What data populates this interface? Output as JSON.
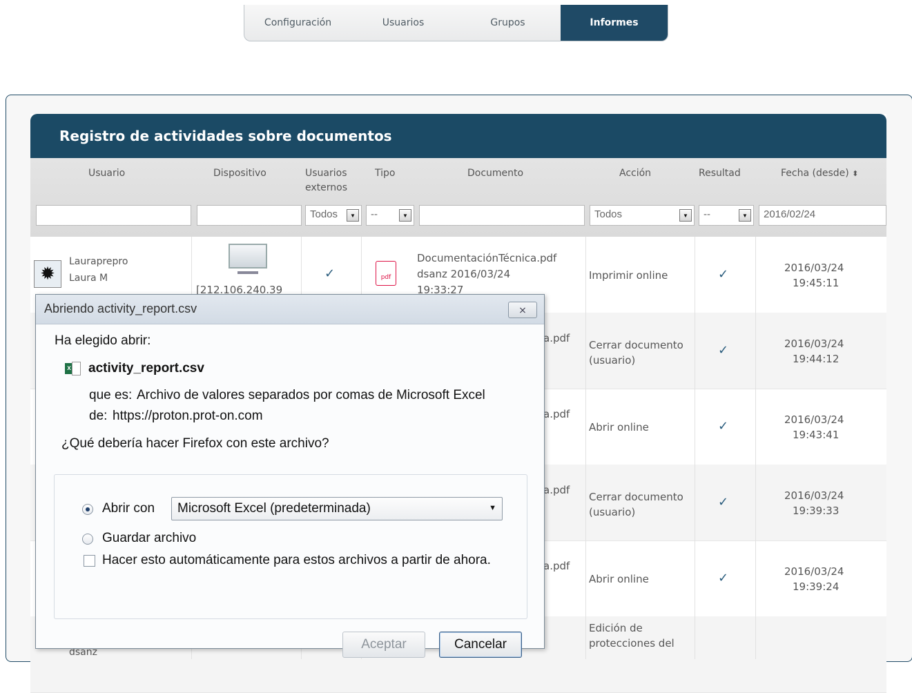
{
  "nav": {
    "tabs": [
      "Configuración",
      "Usuarios",
      "Grupos",
      "Informes"
    ],
    "active": "Informes"
  },
  "panel": {
    "title": "Registro de actividades sobre documentos"
  },
  "columns": [
    "Usuario",
    "Dispositivo",
    "Usuarios externos",
    "Tipo",
    "Documento",
    "Acción",
    "Resultad",
    "Fecha (desde)"
  ],
  "filters": {
    "usuarios_externos": "Todos",
    "tipo": "--",
    "accion": "Todos",
    "resultado": "--",
    "fecha": "2016/02/24"
  },
  "rows": [
    {
      "user_login": "Lauraprepro",
      "user_name": "Laura M",
      "device": "[212.106.240.39",
      "external": "✓",
      "doc": "DocumentaciónTécnica.pdf",
      "doc_meta": "dsanz 2016/03/24",
      "doc_time": "19:33:27",
      "action": "Imprimir online",
      "result": "✓",
      "date": "2016/03/24",
      "time": "19:45:11"
    },
    {
      "doc_tail": "a.pdf",
      "action": "Cerrar documento (usuario)",
      "result": "✓",
      "date": "2016/03/24",
      "time": "19:44:12"
    },
    {
      "doc_tail": "a.pdf",
      "action": "Abrir online",
      "result": "✓",
      "date": "2016/03/24",
      "time": "19:43:41"
    },
    {
      "doc_tail": "a.pdf",
      "action": "Cerrar documento (usuario)",
      "result": "✓",
      "date": "2016/03/24",
      "time": "19:39:33"
    },
    {
      "doc_tail": "a.pdf",
      "action": "Abrir online",
      "result": "✓",
      "date": "2016/03/24",
      "time": "19:39:24"
    },
    {
      "user_login": "dsanz",
      "action": "Edición de protecciones del"
    }
  ],
  "dialog": {
    "title": "Abriendo activity_report.csv",
    "close_label": "⨯",
    "chosen": "Ha elegido abrir:",
    "filename": "activity_report.csv",
    "type_label": "que es:",
    "type_value": "Archivo de valores separados por comas de Microsoft Excel",
    "from_label": "de:",
    "from_value": "https://proton.prot-on.com",
    "question": "¿Qué debería hacer Firefox con este archivo?",
    "open_with": "Abrir con",
    "app": "Microsoft Excel (predeterminada)",
    "save": "Guardar archivo",
    "auto": "Hacer esto automáticamente para estos archivos a partir de ahora.",
    "ok": "Aceptar",
    "cancel": "Cancelar"
  }
}
